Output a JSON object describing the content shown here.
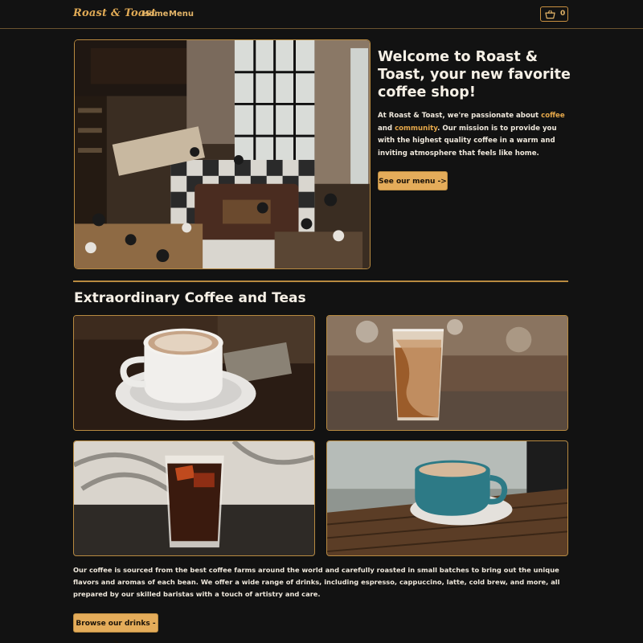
{
  "nav": {
    "logo": "Roast & Toast",
    "links": [
      "Home",
      "Menu"
    ],
    "cart_count": "0"
  },
  "hero": {
    "title": "Welcome to Roast & Toast, your new favorite coffee shop!",
    "text_parts": [
      "At Roast & Toast, we're passionate about ",
      "coffee",
      " and ",
      "community",
      ". Our mission is to provide you with the highest quality coffee in a warm and inviting atmosphere that feels like home."
    ],
    "button": "See our menu ->",
    "image_alt": "Interior of a busy coffee shop viewed from above"
  },
  "section": {
    "title": "Extraordinary Coffee and Teas",
    "images": [
      "Cappuccino with cocoa on a white saucer",
      "Iced coffee with cream in a tall glass",
      "Cold brew with ice in a glass",
      "Latte in a teal cup on a wooden table"
    ],
    "description": "Our coffee is sourced from the best coffee farms around the world and carefully roasted in small batches to bring out the unique flavors and aromas of each bean. We offer a wide range of drinks, including espresso, cappuccino, latte, cold brew, and more, all prepared by our skilled baristas with a touch of artistry and care.",
    "button": "Browse our drinks ->"
  },
  "colors": {
    "background": "#121212",
    "accent": "#e4ac5a",
    "text": "#f2ede4"
  }
}
